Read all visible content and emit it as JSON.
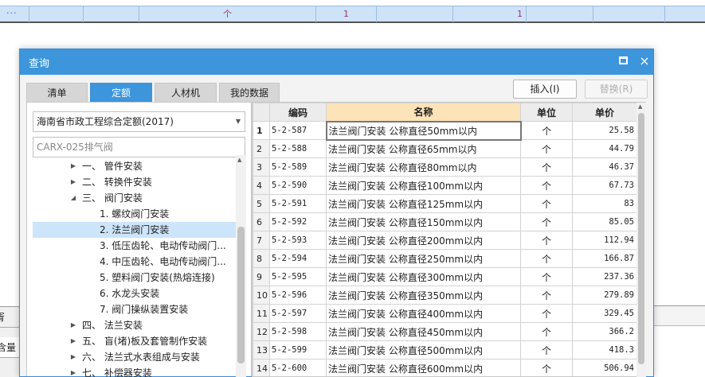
{
  "background_sheet": {
    "row_dots": "···",
    "cell_unit": "个",
    "cell_qty1": "1",
    "cell_qty2": "1",
    "left_tab1": "胥",
    "left_tab2": "含量"
  },
  "dialog": {
    "title": "查询",
    "maximize_icon": "maximize-icon",
    "close_label": "×",
    "tabs": [
      {
        "label": "清单",
        "active": false
      },
      {
        "label": "定额",
        "active": true
      },
      {
        "label": "人材机",
        "active": false
      },
      {
        "label": "我的数据",
        "active": false
      }
    ],
    "insert_button": "插入(I)",
    "replace_button": "替换(R)",
    "quota_library": "海南省市政工程综合定额(2017)",
    "search_value": "CARX-025排气阀",
    "tree": [
      {
        "toggle": "▶",
        "label": "一、 管件安装",
        "level": 0
      },
      {
        "toggle": "▶",
        "label": "二、 转换件安装",
        "level": 0
      },
      {
        "toggle": "◢",
        "label": "三、 阀门安装",
        "level": 0
      },
      {
        "toggle": "",
        "label": "1. 螺纹阀门安装",
        "level": 1
      },
      {
        "toggle": "",
        "label": "2. 法兰阀门安装",
        "level": 1,
        "selected": true
      },
      {
        "toggle": "",
        "label": "3. 低压齿轮、电动传动阀门...",
        "level": 1
      },
      {
        "toggle": "",
        "label": "4. 中压齿轮、电动传动阀门...",
        "level": 1
      },
      {
        "toggle": "",
        "label": "5. 塑料阀门安装(热熔连接)",
        "level": 1
      },
      {
        "toggle": "",
        "label": "6. 水龙头安装",
        "level": 1
      },
      {
        "toggle": "",
        "label": "7. 阀门操纵装置安装",
        "level": 1
      },
      {
        "toggle": "▶",
        "label": "四、 法兰安装",
        "level": 0
      },
      {
        "toggle": "▶",
        "label": "五、 盲(堵)板及套管制作安装",
        "level": 0
      },
      {
        "toggle": "▶",
        "label": "六、 法兰式水表组成与安装",
        "level": 0
      },
      {
        "toggle": "▶",
        "label": "七、 补偿器安装",
        "level": 0
      }
    ],
    "table": {
      "headers": {
        "code": "编码",
        "name": "名称",
        "unit": "单位",
        "price": "单价"
      },
      "rows": [
        {
          "n": "1",
          "code": "5-2-587",
          "name": "法兰阀门安装 公称直径50mm以内",
          "unit": "个",
          "price": "25.58"
        },
        {
          "n": "2",
          "code": "5-2-588",
          "name": "法兰阀门安装 公称直径65mm以内",
          "unit": "个",
          "price": "44.79"
        },
        {
          "n": "3",
          "code": "5-2-589",
          "name": "法兰阀门安装 公称直径80mm以内",
          "unit": "个",
          "price": "46.37"
        },
        {
          "n": "4",
          "code": "5-2-590",
          "name": "法兰阀门安装 公称直径100mm以内",
          "unit": "个",
          "price": "67.73"
        },
        {
          "n": "5",
          "code": "5-2-591",
          "name": "法兰阀门安装 公称直径125mm以内",
          "unit": "个",
          "price": "83"
        },
        {
          "n": "6",
          "code": "5-2-592",
          "name": "法兰阀门安装 公称直径150mm以内",
          "unit": "个",
          "price": "85.05"
        },
        {
          "n": "7",
          "code": "5-2-593",
          "name": "法兰阀门安装 公称直径200mm以内",
          "unit": "个",
          "price": "112.94"
        },
        {
          "n": "8",
          "code": "5-2-594",
          "name": "法兰阀门安装 公称直径250mm以内",
          "unit": "个",
          "price": "166.87"
        },
        {
          "n": "9",
          "code": "5-2-595",
          "name": "法兰阀门安装 公称直径300mm以内",
          "unit": "个",
          "price": "237.36"
        },
        {
          "n": "10",
          "code": "5-2-596",
          "name": "法兰阀门安装 公称直径350mm以内",
          "unit": "个",
          "price": "279.89"
        },
        {
          "n": "11",
          "code": "5-2-597",
          "name": "法兰阀门安装 公称直径400mm以内",
          "unit": "个",
          "price": "329.45"
        },
        {
          "n": "12",
          "code": "5-2-598",
          "name": "法兰阀门安装 公称直径450mm以内",
          "unit": "个",
          "price": "366.2"
        },
        {
          "n": "13",
          "code": "5-2-599",
          "name": "法兰阀门安装 公称直径500mm以内",
          "unit": "个",
          "price": "418.3"
        },
        {
          "n": "14",
          "code": "5-2-600",
          "name": "法兰阀门安装 公称直径600mm以内",
          "unit": "个",
          "price": "506.94"
        }
      ]
    }
  },
  "colors": {
    "accent": "#3d95dc",
    "header_highlight": "#fde3b8",
    "selection": "#cde5fb"
  }
}
